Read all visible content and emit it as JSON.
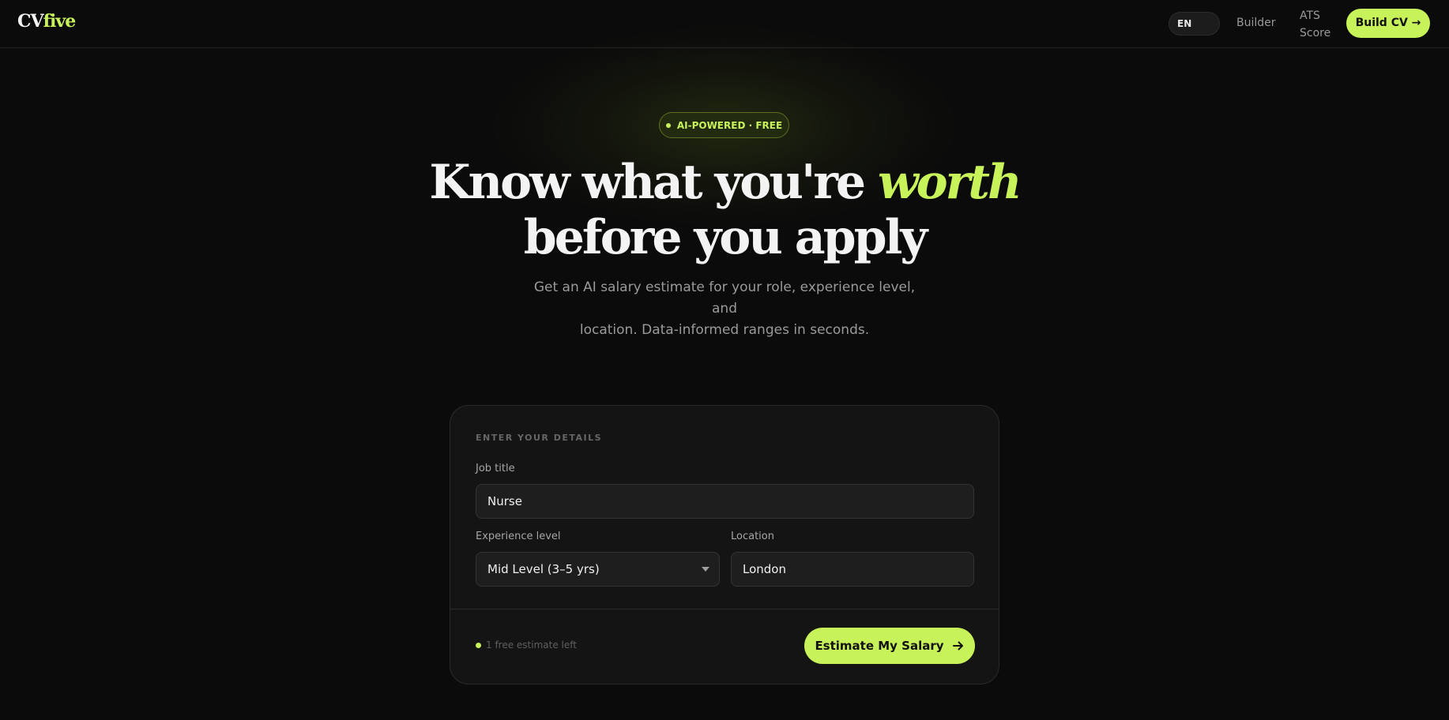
{
  "header": {
    "logo_part1": "CV",
    "logo_part2": "five",
    "language": "EN",
    "nav_builder": "Builder",
    "nav_ats_line1": "ATS",
    "nav_ats_line2": "Score",
    "cta": "Build CV →"
  },
  "hero": {
    "badge": "AI-POWERED · FREE",
    "title_line1": "Know what you're",
    "title_accent": "worth",
    "title_line2": "before you apply",
    "subtitle_line1": "Get an AI salary estimate for your role, experience level, and",
    "subtitle_line2": "location. Data-informed ranges in seconds."
  },
  "form": {
    "section_label": "ENTER YOUR DETAILS",
    "job_title_label": "Job title",
    "job_title_value": "Nurse",
    "experience_label": "Experience level",
    "experience_value": "Mid Level (3–5 yrs)",
    "location_label": "Location",
    "location_value": "London",
    "free_note": "1 free estimate left",
    "submit_label": "Estimate My Salary"
  },
  "colors": {
    "accent": "#c8f25a",
    "background": "#0b0b0b",
    "card": "#141414"
  },
  "icons": {
    "submit": "arrow-right-icon",
    "select": "chevron-down-icon"
  }
}
